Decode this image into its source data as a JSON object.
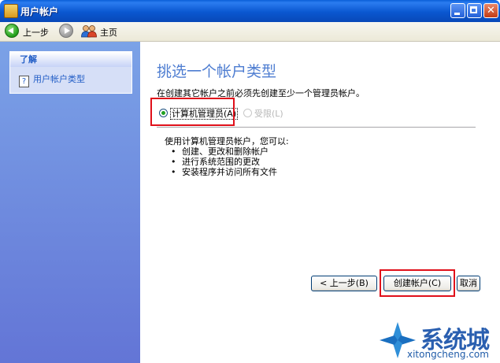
{
  "window": {
    "title": "用户帐户"
  },
  "toolbar": {
    "back_label": "上一步",
    "home_label": "主页"
  },
  "sidebar": {
    "section_title": "了解",
    "items": [
      {
        "label": "用户帐户类型"
      }
    ]
  },
  "main": {
    "title": "挑选一个帐户类型",
    "instruction": "在创建其它帐户之前必须先创建至少一个管理员帐户。",
    "account_types": [
      {
        "label": "计算机管理员(A)",
        "selected": true,
        "enabled": true
      },
      {
        "label": "受限(L)",
        "selected": false,
        "enabled": false
      }
    ],
    "description": "使用计算机管理员帐户，您可以:",
    "bullets": [
      "创建、更改和删除帐户",
      "进行系统范围的更改",
      "安装程序并访问所有文件"
    ],
    "buttons": {
      "back": "< 上一步(B)",
      "create": "创建帐户(C)",
      "cancel": "取消"
    }
  },
  "watermark": {
    "name": "系统城",
    "url": "xitongcheng.com"
  },
  "colors": {
    "highlight": "#e0101a",
    "title_blue": "#4e7dd1",
    "sidebar_gradient_top": "#7ba2e7"
  }
}
